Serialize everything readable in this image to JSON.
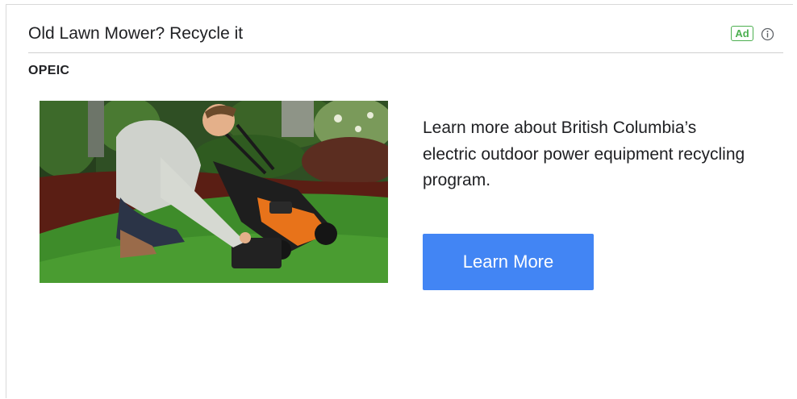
{
  "ad": {
    "headline": "Old Lawn Mower? Recycle it",
    "badge": "Ad",
    "advertiser": "OPEIC",
    "description": "Learn more about British Columbia’s electric outdoor power equipment recycling program.",
    "cta_label": "Learn More",
    "image_icon": "man-with-lawn-mower-photo",
    "info_icon": "info-icon"
  },
  "colors": {
    "badge": "#4caf50",
    "cta_background": "#4285f4",
    "cta_text": "#ffffff",
    "text": "#202124"
  }
}
